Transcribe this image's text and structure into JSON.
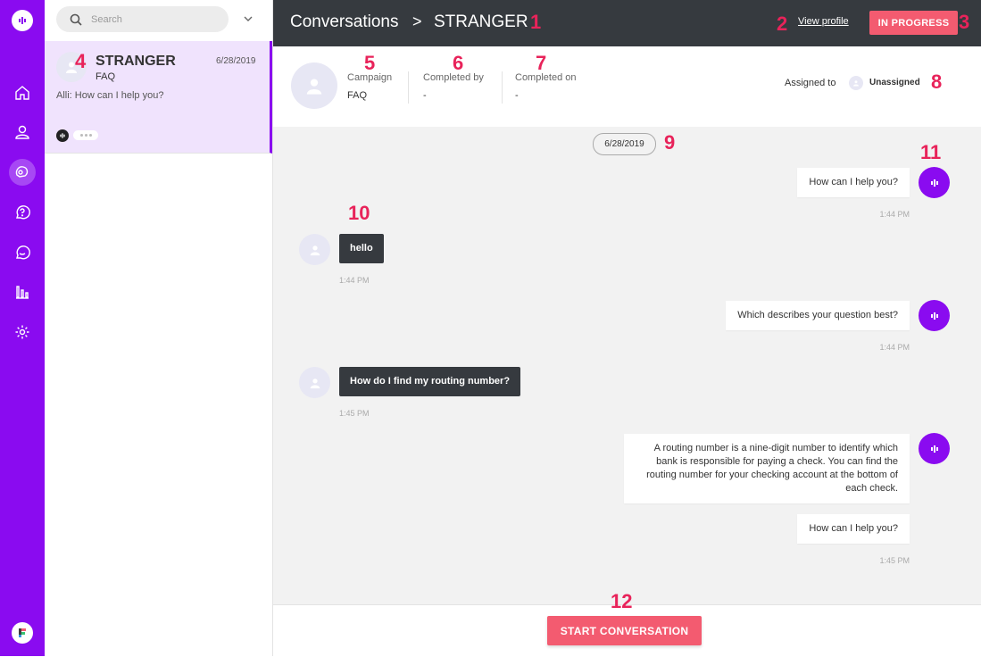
{
  "search": {
    "placeholder": "Search"
  },
  "conversation_item": {
    "name": "STRANGER",
    "date": "6/28/2019",
    "campaign": "FAQ",
    "preview": "Alli: How can I help you?"
  },
  "header": {
    "breadcrumb_root": "Conversations",
    "breadcrumb_separator": ">",
    "breadcrumb_current": "STRANGER",
    "view_profile": "View profile",
    "status": "IN PROGRESS"
  },
  "info": {
    "campaign_label": "Campaign",
    "campaign_value": "FAQ",
    "completed_by_label": "Completed by",
    "completed_by_value": "-",
    "completed_on_label": "Completed on",
    "completed_on_value": "-",
    "assigned_label": "Assigned to",
    "assigned_value": "Unassigned"
  },
  "chat": {
    "date": "6/28/2019",
    "messages": [
      {
        "from": "bot",
        "text": "How can I help you?",
        "time": "1:44 PM"
      },
      {
        "from": "user",
        "text": "hello",
        "time": "1:44 PM"
      },
      {
        "from": "bot",
        "text": "Which describes your question best?",
        "time": "1:44 PM"
      },
      {
        "from": "user",
        "text": "How do I find my routing number?",
        "time": "1:45 PM"
      },
      {
        "from": "bot",
        "text": "A routing number is a nine-digit number to identify which bank is responsible for paying a check. You can find the routing number for your checking account at the bottom of each check.",
        "time": ""
      },
      {
        "from": "bot",
        "text": "How can I help you?",
        "time": "1:45 PM"
      }
    ]
  },
  "footer": {
    "start_label": "START CONVERSATION"
  },
  "annotations": [
    "1",
    "2",
    "3",
    "4",
    "5",
    "6",
    "7",
    "8",
    "9",
    "10",
    "11",
    "12"
  ],
  "colors": {
    "rail": "#8a0bf0",
    "accent": "#f35b70",
    "header": "#363a3f"
  },
  "icons": [
    "alli-logo-icon",
    "home-icon",
    "user-icon",
    "conversations-icon",
    "faq-icon",
    "chat-icon",
    "analytics-icon",
    "settings-icon",
    "brand-icon",
    "search-icon",
    "chevron-down-icon",
    "bot-avatar-icon",
    "user-avatar-icon"
  ]
}
